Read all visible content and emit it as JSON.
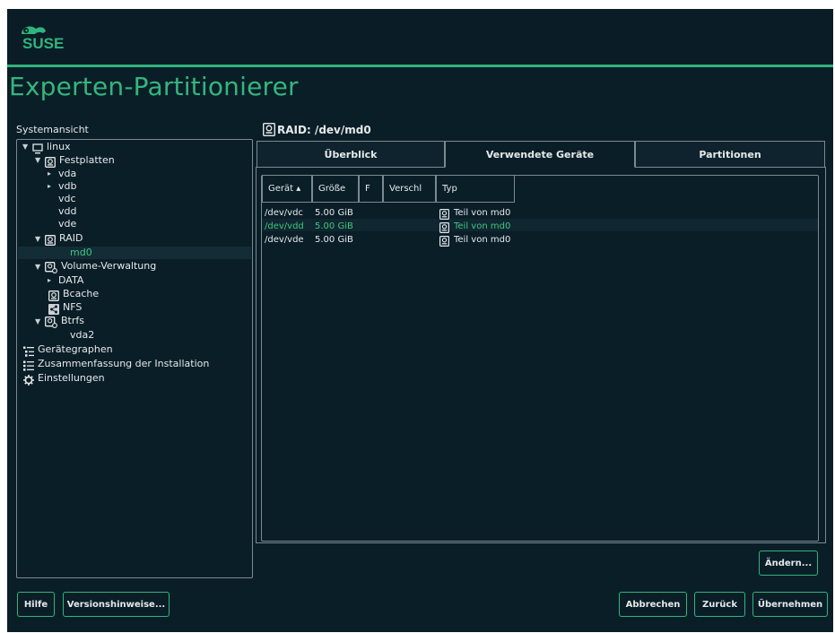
{
  "header": {
    "brand": "SUSE"
  },
  "page": {
    "title": "Experten-Partitionierer"
  },
  "sidebar": {
    "label": "Systemansicht",
    "items": [
      {
        "label": "linux"
      },
      {
        "label": "Festplatten"
      },
      {
        "label": "vda"
      },
      {
        "label": "vdb"
      },
      {
        "label": "vdc"
      },
      {
        "label": "vdd"
      },
      {
        "label": "vde"
      },
      {
        "label": "RAID"
      },
      {
        "label": "md0"
      },
      {
        "label": "Volume-Verwaltung"
      },
      {
        "label": "DATA"
      },
      {
        "label": "Bcache"
      },
      {
        "label": "NFS"
      },
      {
        "label": "Btrfs"
      },
      {
        "label": "vda2"
      },
      {
        "label": "Gerätegraphen"
      },
      {
        "label": "Zusammenfassung der Installation"
      },
      {
        "label": "Einstellungen"
      }
    ]
  },
  "main": {
    "heading": "RAID: /dev/md0",
    "tabs": [
      {
        "label": "Überblick"
      },
      {
        "label": "Verwendete Geräte"
      },
      {
        "label": "Partitionen"
      }
    ],
    "table": {
      "columns": [
        "Gerät ▴",
        "Größe",
        "F",
        "Verschl",
        "Typ"
      ],
      "rows": [
        {
          "device": "/dev/vdc",
          "size": "5.00 GiB",
          "type": "Teil von md0"
        },
        {
          "device": "/dev/vdd",
          "size": "5.00 GiB",
          "type": "Teil von md0"
        },
        {
          "device": "/dev/vde",
          "size": "5.00 GiB",
          "type": "Teil von md0"
        }
      ]
    },
    "change_button": "Ändern..."
  },
  "footer": {
    "help": "Hilfe",
    "release_notes": "Versionshinweise...",
    "abort": "Abbrechen",
    "back": "Zurück",
    "accept": "Übernehmen"
  },
  "colors": {
    "accent": "#30b47d",
    "background": "#0a1e27",
    "selected_text": "#3ec87f"
  }
}
